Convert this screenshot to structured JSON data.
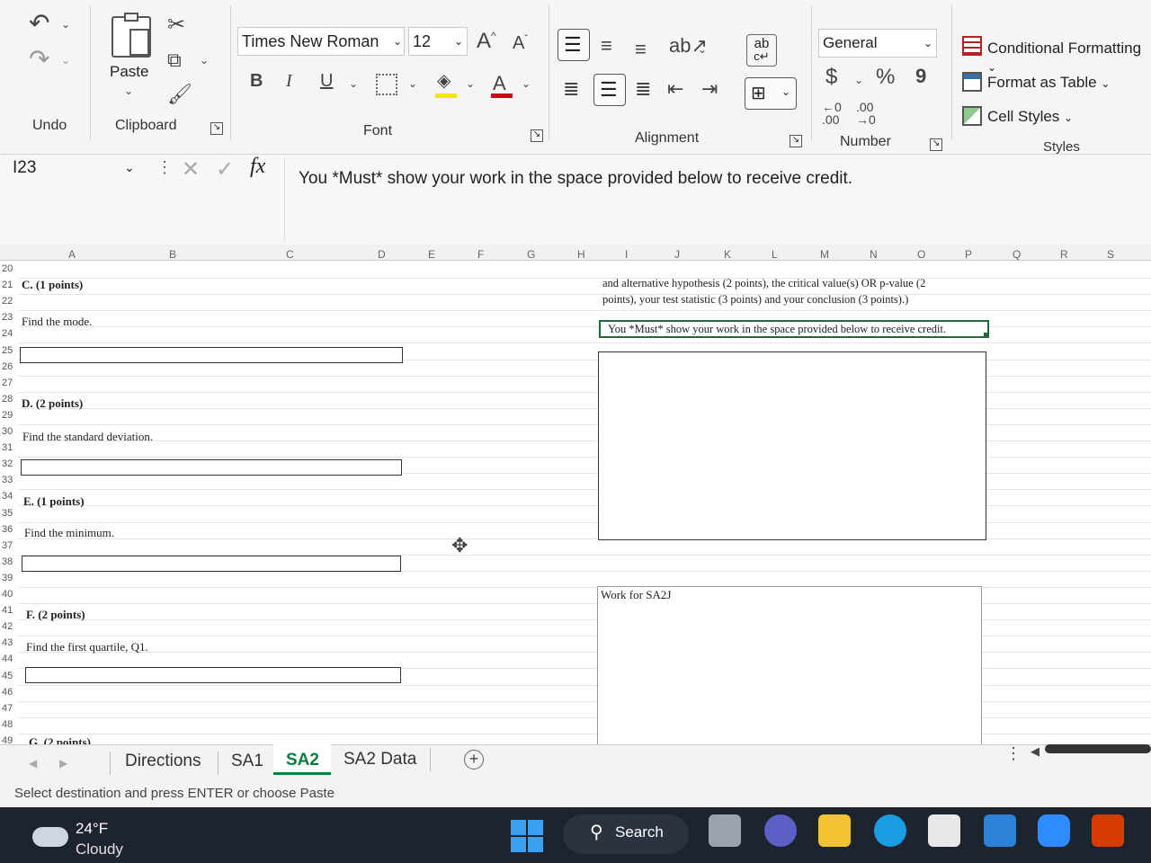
{
  "ribbon": {
    "groups": {
      "undo": "Undo",
      "clipboard": "Clipboard",
      "font": "Font",
      "alignment": "Alignment",
      "number": "Number",
      "styles": "Styles"
    },
    "paste_label": "Paste",
    "font_name": "Times New Roman",
    "font_size": "12",
    "number_format": "General",
    "bold": "B",
    "italic": "I",
    "underline": "U",
    "currency": "$",
    "percent": "%",
    "comma": "9",
    "conditional_formatting": "Conditional Formatting",
    "format_as_table": "Format as Table",
    "cell_styles": "Cell Styles",
    "wrap_icon_text": "ab"
  },
  "formula_bar": {
    "name_box": "I23",
    "fx": "fx",
    "content": "You *Must* show your work in the space provided below to receive credit."
  },
  "columns": [
    "A",
    "B",
    "C",
    "D",
    "E",
    "F",
    "G",
    "H",
    "I",
    "J",
    "K",
    "L",
    "M",
    "N",
    "O",
    "P",
    "Q",
    "R",
    "S"
  ],
  "rows": [
    "20",
    "21",
    "22",
    "23",
    "24",
    "25",
    "26",
    "27",
    "28",
    "29",
    "30",
    "31",
    "32",
    "33",
    "34",
    "35",
    "36",
    "37",
    "38",
    "39",
    "40",
    "41",
    "42",
    "43",
    "44",
    "45",
    "46",
    "47",
    "48",
    "49"
  ],
  "sheet": {
    "c_heading": "C. (1 points)",
    "c_prompt": "Find the mode.",
    "d_heading": "D. (2 points)",
    "d_prompt": "Find the standard deviation.",
    "e_heading": "E. (1 points)",
    "e_prompt": "Find the minimum.",
    "f_heading": "F. (2 points)",
    "f_prompt": "Find the first quartile, Q1.",
    "g_heading": "G. (2 points)",
    "right_line1": "and alternative hypothesis (2 points), the critical value(s) OR p-value (2",
    "right_line2": "points), your test statistic (3 points) and your conclusion (3 points).)",
    "right_notice": "You *Must* show your work in the space provided below to receive credit.",
    "work_label": "Work for SA2J"
  },
  "tabs": [
    "Directions",
    "SA1",
    "SA2",
    "SA2 Data"
  ],
  "active_tab": "SA2",
  "status_text": "Select destination and press ENTER or choose Paste",
  "weather": {
    "temp": "24°F",
    "condition": "Cloudy"
  },
  "taskbar": {
    "search": "Search"
  },
  "colors": {
    "accent": "#107c41",
    "taskbar": "#1d2430"
  }
}
